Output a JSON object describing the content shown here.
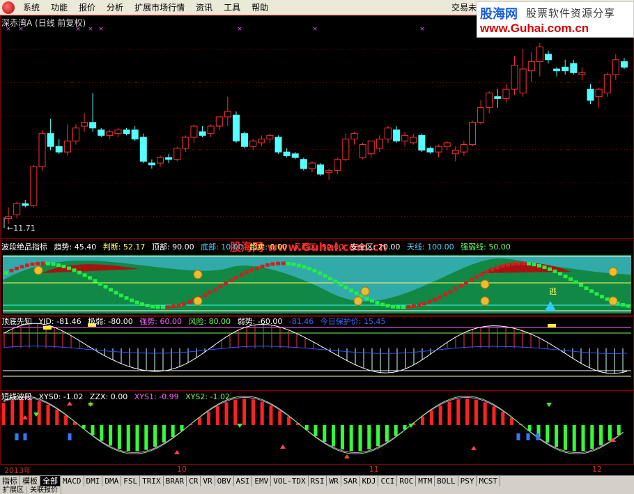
{
  "menu": {
    "items": [
      "系统",
      "功能",
      "报价",
      "分析",
      "扩展市场行情",
      "资讯",
      "工具",
      "帮助"
    ],
    "right_text": "交易未"
  },
  "watermark": {
    "name": "股海网",
    "tagline": "股票软件资源分享",
    "url": "www.Guhai.com.cn"
  },
  "main_chart": {
    "title": "深赤湾A (日线 前复权)",
    "low_label": "11.71"
  },
  "panel1": {
    "label_name": "波段绝品指标",
    "items": [
      {
        "text": "趋势: 45.40",
        "color": "#ffffff"
      },
      {
        "text": "判断: 52.17",
        "color": "#ffff66"
      },
      {
        "text": "顶部: 90.00",
        "color": "#ffffff"
      },
      {
        "text": "底部: 10.00",
        "color": "#55ccff"
      },
      {
        "text": "超卖: 0.00",
        "color": "#ffff66"
      },
      {
        "text": "风险区: 80.00",
        "color": "#ff4444"
      },
      {
        "text": "安全区: 20.00",
        "color": "#ffffff"
      },
      {
        "text": "天线: 100.00",
        "color": "#55ccff"
      },
      {
        "text": "强弱线: 50.00",
        "color": "#66ff66"
      }
    ],
    "overlay": "股海网 www.Guhai.com.cn",
    "escape_label": "逃"
  },
  "panel2": {
    "label_name": "顶底先知",
    "items": [
      {
        "text": "YJD: -81.46",
        "color": "#ffffff"
      },
      {
        "text": "极弱: -80.00",
        "color": "#ffffff"
      },
      {
        "text": "强势: 60.00",
        "color": "#ff66ff"
      },
      {
        "text": "风险: 80.00",
        "color": "#66ff66"
      },
      {
        "text": "弱势: -60.00",
        "color": "#ffffff"
      },
      {
        "text": "-81.46",
        "color": "#4466ff"
      },
      {
        "text": "今日保护价: 15.45",
        "color": "#4466ff"
      }
    ]
  },
  "panel3": {
    "label_name": "短线波段",
    "items": [
      {
        "text": "XYS0: -1.02",
        "color": "#ffffff"
      },
      {
        "text": "ZZX: 0.00",
        "color": "#ffffff"
      },
      {
        "text": "XYS1: -0.99",
        "color": "#ff66ff"
      },
      {
        "text": "XYS2: -1.02",
        "color": "#66ff66"
      }
    ]
  },
  "date_axis": [
    "2013年",
    "10",
    "11",
    "12"
  ],
  "bottom_tabs": [
    "指标",
    "模板",
    "全部",
    "MACD",
    "DMI",
    "DMA",
    "FSL",
    "TRIX",
    "BRAR",
    "CR",
    "VR",
    "OBV",
    "ASI",
    "EMV",
    "VOL-TDX",
    "RSI",
    "WR",
    "SAR",
    "KDJ",
    "CCI",
    "ROC",
    "MTM",
    "BOLL",
    "PSY",
    "MCST"
  ],
  "status_tabs": [
    "扩展区",
    "关联报价"
  ],
  "colors": {
    "up": "#ff3232",
    "down": "#54ffff",
    "grid": "#800000"
  },
  "chart_data": {
    "type": "candlestick",
    "candles": [
      {
        "o": 12.0,
        "h": 12.6,
        "l": 11.71,
        "c": 12.1
      },
      {
        "o": 12.2,
        "h": 12.9,
        "l": 12.0,
        "c": 12.8
      },
      {
        "o": 12.8,
        "h": 13.0,
        "l": 12.6,
        "c": 12.7
      },
      {
        "o": 12.7,
        "h": 14.9,
        "l": 12.6,
        "c": 14.8
      },
      {
        "o": 14.8,
        "h": 16.8,
        "l": 14.6,
        "c": 16.6
      },
      {
        "o": 16.6,
        "h": 17.4,
        "l": 15.7,
        "c": 15.9
      },
      {
        "o": 15.9,
        "h": 16.3,
        "l": 15.5,
        "c": 15.6
      },
      {
        "o": 15.6,
        "h": 17.1,
        "l": 15.4,
        "c": 16.2
      },
      {
        "o": 16.2,
        "h": 17.1,
        "l": 16.0,
        "c": 16.9
      },
      {
        "o": 17.0,
        "h": 17.7,
        "l": 16.7,
        "c": 17.2
      },
      {
        "o": 17.2,
        "h": 18.8,
        "l": 16.7,
        "c": 16.9
      },
      {
        "o": 16.8,
        "h": 16.9,
        "l": 16.4,
        "c": 16.5
      },
      {
        "o": 16.5,
        "h": 16.8,
        "l": 16.3,
        "c": 16.7
      },
      {
        "o": 16.6,
        "h": 16.9,
        "l": 16.4,
        "c": 16.8
      },
      {
        "o": 16.8,
        "h": 16.9,
        "l": 16.5,
        "c": 16.6
      },
      {
        "o": 16.8,
        "h": 17.0,
        "l": 16.2,
        "c": 16.3
      },
      {
        "o": 16.4,
        "h": 16.6,
        "l": 15.0,
        "c": 15.1
      },
      {
        "o": 15.0,
        "h": 15.2,
        "l": 14.7,
        "c": 14.9
      },
      {
        "o": 15.0,
        "h": 15.4,
        "l": 14.8,
        "c": 15.3
      },
      {
        "o": 15.3,
        "h": 15.5,
        "l": 15.0,
        "c": 15.2
      },
      {
        "o": 15.2,
        "h": 15.9,
        "l": 15.1,
        "c": 15.8
      },
      {
        "o": 15.8,
        "h": 16.5,
        "l": 15.6,
        "c": 16.4
      },
      {
        "o": 16.4,
        "h": 17.1,
        "l": 16.1,
        "c": 17.0
      },
      {
        "o": 16.7,
        "h": 17.0,
        "l": 16.4,
        "c": 16.5
      },
      {
        "o": 16.6,
        "h": 17.1,
        "l": 16.4,
        "c": 17.0
      },
      {
        "o": 17.0,
        "h": 17.5,
        "l": 16.8,
        "c": 17.5
      },
      {
        "o": 17.5,
        "h": 18.6,
        "l": 17.0,
        "c": 17.8
      },
      {
        "o": 17.6,
        "h": 17.8,
        "l": 16.1,
        "c": 16.2
      },
      {
        "o": 16.6,
        "h": 16.7,
        "l": 15.8,
        "c": 15.9
      },
      {
        "o": 15.9,
        "h": 16.3,
        "l": 15.7,
        "c": 16.2
      },
      {
        "o": 16.1,
        "h": 16.5,
        "l": 15.9,
        "c": 16.3
      },
      {
        "o": 16.3,
        "h": 16.6,
        "l": 16.1,
        "c": 16.5
      },
      {
        "o": 16.4,
        "h": 16.5,
        "l": 15.5,
        "c": 15.6
      },
      {
        "o": 15.6,
        "h": 15.8,
        "l": 15.3,
        "c": 15.4
      },
      {
        "o": 15.5,
        "h": 15.6,
        "l": 15.2,
        "c": 15.3
      },
      {
        "o": 15.2,
        "h": 15.3,
        "l": 14.6,
        "c": 14.7
      },
      {
        "o": 14.7,
        "h": 15.1,
        "l": 14.5,
        "c": 15.0
      },
      {
        "o": 14.9,
        "h": 15.0,
        "l": 14.3,
        "c": 14.4
      },
      {
        "o": 14.5,
        "h": 14.7,
        "l": 14.1,
        "c": 14.6
      },
      {
        "o": 14.6,
        "h": 15.3,
        "l": 14.4,
        "c": 15.2
      },
      {
        "o": 15.2,
        "h": 16.6,
        "l": 15.1,
        "c": 16.3
      },
      {
        "o": 16.3,
        "h": 16.7,
        "l": 16.0,
        "c": 16.6
      },
      {
        "o": 15.3,
        "h": 16.1,
        "l": 15.2,
        "c": 16.0
      },
      {
        "o": 15.5,
        "h": 16.2,
        "l": 15.3,
        "c": 16.2
      },
      {
        "o": 15.8,
        "h": 16.5,
        "l": 15.6,
        "c": 16.3
      },
      {
        "o": 16.3,
        "h": 17.0,
        "l": 16.1,
        "c": 16.9
      },
      {
        "o": 16.8,
        "h": 17.0,
        "l": 16.1,
        "c": 16.2
      },
      {
        "o": 16.2,
        "h": 16.7,
        "l": 15.9,
        "c": 16.5
      },
      {
        "o": 16.1,
        "h": 16.6,
        "l": 16.0,
        "c": 16.4
      },
      {
        "o": 16.5,
        "h": 16.6,
        "l": 15.6,
        "c": 15.7
      },
      {
        "o": 15.8,
        "h": 15.9,
        "l": 15.5,
        "c": 15.6
      },
      {
        "o": 15.6,
        "h": 16.0,
        "l": 15.3,
        "c": 15.9
      },
      {
        "o": 15.9,
        "h": 16.2,
        "l": 15.7,
        "c": 16.1
      },
      {
        "o": 15.5,
        "h": 15.9,
        "l": 15.1,
        "c": 15.7
      },
      {
        "o": 15.6,
        "h": 16.2,
        "l": 15.4,
        "c": 16.0
      },
      {
        "o": 16.0,
        "h": 17.3,
        "l": 15.9,
        "c": 17.2
      },
      {
        "o": 17.2,
        "h": 18.4,
        "l": 17.1,
        "c": 18.0
      },
      {
        "o": 18.0,
        "h": 18.9,
        "l": 17.7,
        "c": 18.8
      },
      {
        "o": 18.6,
        "h": 19.0,
        "l": 18.0,
        "c": 18.5
      },
      {
        "o": 18.5,
        "h": 19.3,
        "l": 18.3,
        "c": 19.0
      },
      {
        "o": 19.0,
        "h": 20.8,
        "l": 18.7,
        "c": 20.3
      },
      {
        "o": 18.8,
        "h": 21.2,
        "l": 18.6,
        "c": 20.1
      },
      {
        "o": 20.0,
        "h": 21.0,
        "l": 19.4,
        "c": 20.5
      },
      {
        "o": 20.5,
        "h": 21.5,
        "l": 19.7,
        "c": 21.3
      },
      {
        "o": 20.9,
        "h": 21.1,
        "l": 20.4,
        "c": 20.6
      },
      {
        "o": 20.1,
        "h": 20.2,
        "l": 19.7,
        "c": 20.0
      },
      {
        "o": 20.2,
        "h": 20.6,
        "l": 19.8,
        "c": 20.0
      },
      {
        "o": 20.4,
        "h": 20.6,
        "l": 19.8,
        "c": 19.9
      },
      {
        "o": 19.8,
        "h": 20.2,
        "l": 19.5,
        "c": 19.9
      },
      {
        "o": 19.0,
        "h": 19.3,
        "l": 18.2,
        "c": 18.4
      },
      {
        "o": 18.6,
        "h": 19.1,
        "l": 18.0,
        "c": 19.0
      },
      {
        "o": 18.8,
        "h": 19.9,
        "l": 18.6,
        "c": 19.8
      },
      {
        "o": 19.8,
        "h": 20.9,
        "l": 19.5,
        "c": 20.6
      },
      {
        "o": 20.5,
        "h": 20.7,
        "l": 20.1,
        "c": 20.2
      }
    ],
    "ylim": [
      11.3,
      21.8
    ]
  }
}
